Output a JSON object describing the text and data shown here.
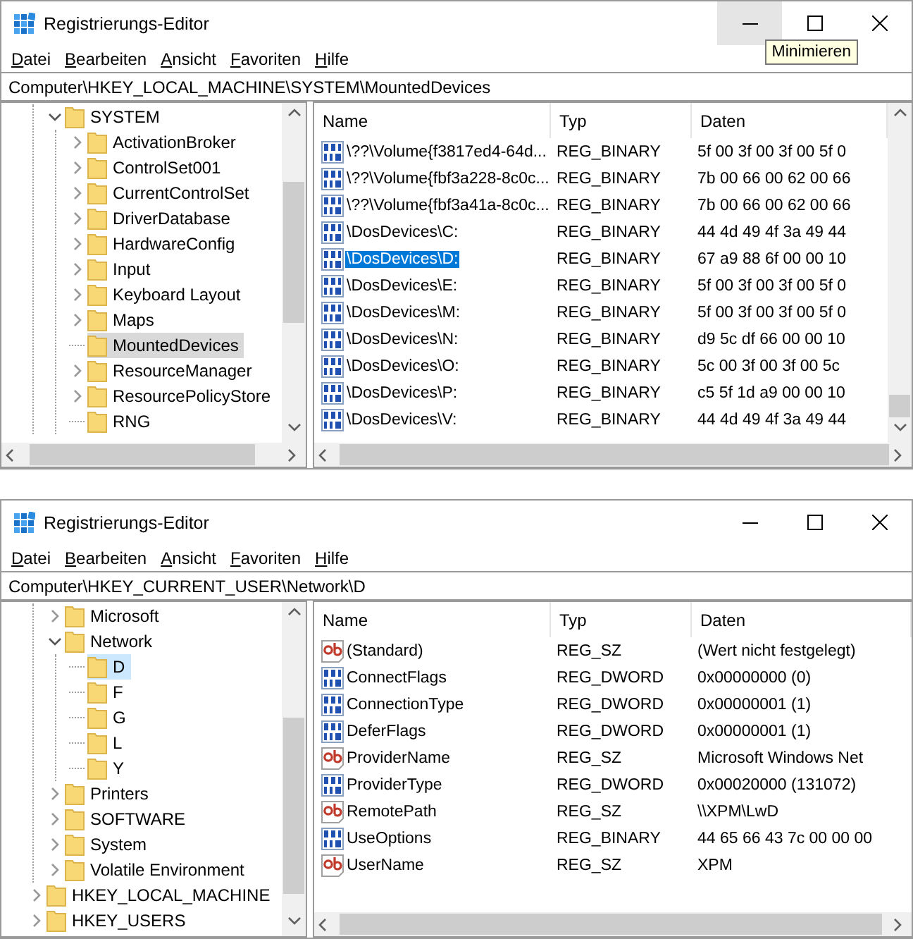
{
  "windows": [
    {
      "title": "Registrierungs-Editor",
      "minimize_hovered": true,
      "tooltip": "Minimieren",
      "menu": [
        "Datei",
        "Bearbeiten",
        "Ansicht",
        "Favoriten",
        "Hilfe"
      ],
      "address": "Computer\\HKEY_LOCAL_MACHINE\\SYSTEM\\MountedDevices",
      "tree_focused": false,
      "tree_horizontal_scrollbar": true,
      "list_vertical_scrollbar": true,
      "tree": [
        {
          "children": [
            {
              "label": "SYSTEM",
              "has_children": true,
              "expanded": true,
              "selected": false,
              "children": [
                {
                  "label": "ActivationBroker",
                  "has_children": true,
                  "expanded": false,
                  "selected": false
                },
                {
                  "label": "ControlSet001",
                  "has_children": true,
                  "expanded": false,
                  "selected": false
                },
                {
                  "label": "CurrentControlSet",
                  "has_children": true,
                  "expanded": false,
                  "selected": false
                },
                {
                  "label": "DriverDatabase",
                  "has_children": true,
                  "expanded": false,
                  "selected": false
                },
                {
                  "label": "HardwareConfig",
                  "has_children": true,
                  "expanded": false,
                  "selected": false
                },
                {
                  "label": "Input",
                  "has_children": true,
                  "expanded": false,
                  "selected": false
                },
                {
                  "label": "Keyboard Layout",
                  "has_children": true,
                  "expanded": false,
                  "selected": false
                },
                {
                  "label": "Maps",
                  "has_children": true,
                  "expanded": false,
                  "selected": false
                },
                {
                  "label": "MountedDevices",
                  "has_children": false,
                  "selected": true
                },
                {
                  "label": "ResourceManager",
                  "has_children": true,
                  "expanded": false,
                  "selected": false
                },
                {
                  "label": "ResourcePolicyStore",
                  "has_children": true,
                  "expanded": false,
                  "selected": false
                },
                {
                  "label": "RNG",
                  "has_children": false,
                  "selected": false
                }
              ]
            }
          ]
        }
      ],
      "columns": [
        "Name",
        "Typ",
        "Daten"
      ],
      "values": [
        {
          "kind": "binary",
          "name": "\\??\\Volume{f3817ed4-64d...",
          "type": "REG_BINARY",
          "data": "5f 00 3f 00 3f 00 5f 0",
          "selected": false
        },
        {
          "kind": "binary",
          "name": "\\??\\Volume{fbf3a228-8c0c...",
          "type": "REG_BINARY",
          "data": "7b 00 66 00 62 00 66",
          "selected": false
        },
        {
          "kind": "binary",
          "name": "\\??\\Volume{fbf3a41a-8c0c...",
          "type": "REG_BINARY",
          "data": "7b 00 66 00 62 00 66",
          "selected": false
        },
        {
          "kind": "binary",
          "name": "\\DosDevices\\C:",
          "type": "REG_BINARY",
          "data": "44 4d 49 4f 3a 49 44",
          "selected": false
        },
        {
          "kind": "binary",
          "name": "\\DosDevices\\D:",
          "type": "REG_BINARY",
          "data": "67 a9 88 6f 00 00 10",
          "selected": true
        },
        {
          "kind": "binary",
          "name": "\\DosDevices\\E:",
          "type": "REG_BINARY",
          "data": "5f 00 3f 00 3f 00 5f 0",
          "selected": false
        },
        {
          "kind": "binary",
          "name": "\\DosDevices\\M:",
          "type": "REG_BINARY",
          "data": "5f 00 3f 00 3f 00 5f 0",
          "selected": false
        },
        {
          "kind": "binary",
          "name": "\\DosDevices\\N:",
          "type": "REG_BINARY",
          "data": "d9 5c df 66 00 00 10",
          "selected": false
        },
        {
          "kind": "binary",
          "name": "\\DosDevices\\O:",
          "type": "REG_BINARY",
          "data": "5c 00 3f 00 3f 00 5c",
          "selected": false
        },
        {
          "kind": "binary",
          "name": "\\DosDevices\\P:",
          "type": "REG_BINARY",
          "data": "c5 5f 1d a9 00 00 10",
          "selected": false
        },
        {
          "kind": "binary",
          "name": "\\DosDevices\\V:",
          "type": "REG_BINARY",
          "data": "44 4d 49 4f 3a 49 44",
          "selected": false
        }
      ]
    },
    {
      "title": "Registrierungs-Editor",
      "minimize_hovered": false,
      "menu": [
        "Datei",
        "Bearbeiten",
        "Ansicht",
        "Favoriten",
        "Hilfe"
      ],
      "address": "Computer\\HKEY_CURRENT_USER\\Network\\D",
      "tree_focused": true,
      "tree_horizontal_scrollbar": false,
      "list_vertical_scrollbar": false,
      "tree": [
        {
          "children": [
            {
              "label": "Microsoft",
              "has_children": true,
              "expanded": false,
              "selected": false
            },
            {
              "label": "Network",
              "has_children": true,
              "expanded": true,
              "selected": false,
              "children": [
                {
                  "label": "D",
                  "has_children": false,
                  "selected": true
                },
                {
                  "label": "F",
                  "has_children": false,
                  "selected": false
                },
                {
                  "label": "G",
                  "has_children": false,
                  "selected": false
                },
                {
                  "label": "L",
                  "has_children": false,
                  "selected": false
                },
                {
                  "label": "Y",
                  "has_children": false,
                  "selected": false
                }
              ]
            },
            {
              "label": "Printers",
              "has_children": true,
              "expanded": false,
              "selected": false
            },
            {
              "label": "SOFTWARE",
              "has_children": true,
              "expanded": false,
              "selected": false
            },
            {
              "label": "System",
              "has_children": true,
              "expanded": false,
              "selected": false
            },
            {
              "label": "Volatile Environment",
              "has_children": true,
              "expanded": false,
              "selected": false
            }
          ]
        },
        {
          "label": "HKEY_LOCAL_MACHINE",
          "has_children": true,
          "expanded": false,
          "selected": false
        },
        {
          "label": "HKEY_USERS",
          "has_children": true,
          "expanded": false,
          "selected": false
        }
      ],
      "columns": [
        "Name",
        "Typ",
        "Daten"
      ],
      "values": [
        {
          "kind": "string",
          "name": "(Standard)",
          "type": "REG_SZ",
          "data": "(Wert nicht festgelegt)",
          "selected": false
        },
        {
          "kind": "binary",
          "name": "ConnectFlags",
          "type": "REG_DWORD",
          "data": "0x00000000 (0)",
          "selected": false
        },
        {
          "kind": "binary",
          "name": "ConnectionType",
          "type": "REG_DWORD",
          "data": "0x00000001 (1)",
          "selected": false
        },
        {
          "kind": "binary",
          "name": "DeferFlags",
          "type": "REG_DWORD",
          "data": "0x00000001 (1)",
          "selected": false
        },
        {
          "kind": "string",
          "name": "ProviderName",
          "type": "REG_SZ",
          "data": "Microsoft Windows Net",
          "selected": false
        },
        {
          "kind": "binary",
          "name": "ProviderType",
          "type": "REG_DWORD",
          "data": "0x00020000 (131072)",
          "selected": false
        },
        {
          "kind": "string",
          "name": "RemotePath",
          "type": "REG_SZ",
          "data": "\\\\XPM\\LwD",
          "selected": false
        },
        {
          "kind": "binary",
          "name": "UseOptions",
          "type": "REG_BINARY",
          "data": "44 65 66 43 7c 00 00 00",
          "selected": false
        },
        {
          "kind": "string",
          "name": "UserName",
          "type": "REG_SZ",
          "data": "XPM",
          "selected": false
        }
      ]
    }
  ]
}
